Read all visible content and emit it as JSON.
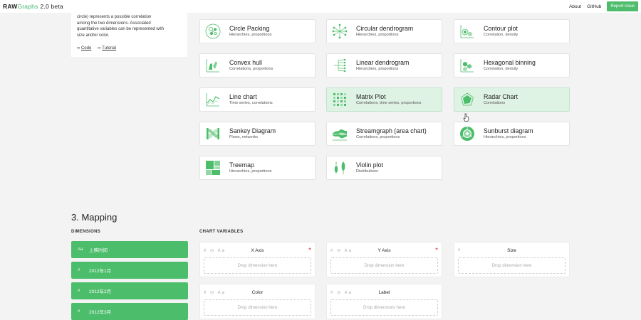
{
  "header": {
    "brand_raw": "RAW",
    "brand_graphs": "Graphs",
    "brand_version": "2.0 beta",
    "nav": [
      "About",
      "GitHub"
    ],
    "report_label": "Report issue"
  },
  "description": {
    "lines": [
      "circle) represents a possible correlation",
      "among the two dimensions. Associated",
      "quantitative variables can be represented with",
      "size and/or color."
    ],
    "code_link": "Code",
    "tutorial_link": "Tutorial"
  },
  "charts": [
    {
      "title": "Circle Packing",
      "subtitle": "Hierarchies, proportions",
      "icon": "circle-packing-icon"
    },
    {
      "title": "Circular dendrogram",
      "subtitle": "Hierarchies, proportions",
      "icon": "circular-dendrogram-icon"
    },
    {
      "title": "Contour plot",
      "subtitle": "Correlation, density",
      "icon": "contour-plot-icon"
    },
    {
      "title": "Convex hull",
      "subtitle": "Correlations, proportions",
      "icon": "convex-hull-icon"
    },
    {
      "title": "Linear dendrogram",
      "subtitle": "Hierarchies, proportions",
      "icon": "linear-dendrogram-icon"
    },
    {
      "title": "Hexagonal binning",
      "subtitle": "Correlation, density",
      "icon": "hexagonal-binning-icon"
    },
    {
      "title": "Line chart",
      "subtitle": "Time series, correlations",
      "icon": "line-chart-icon"
    },
    {
      "title": "Matrix Plot",
      "subtitle": "Correlations, time series, proportions",
      "icon": "matrix-plot-icon"
    },
    {
      "title": "Radar Chart",
      "subtitle": "Correlations",
      "icon": "radar-chart-icon"
    },
    {
      "title": "Sankey Diagram",
      "subtitle": "Flows, networks",
      "icon": "sankey-diagram-icon"
    },
    {
      "title": "Streamgraph (area chart)",
      "subtitle": "Correlations, proportions",
      "icon": "streamgraph-icon"
    },
    {
      "title": "Sunburst diagram",
      "subtitle": "Hierarchies, proportions",
      "icon": "sunburst-diagram-icon"
    },
    {
      "title": "Treemap",
      "subtitle": "Hierarchies, proportions",
      "icon": "treemap-icon"
    },
    {
      "title": "Violin plot",
      "subtitle": "Distributions",
      "icon": "violin-plot-icon"
    }
  ],
  "mapping": {
    "title": "3. Mapping",
    "dimensions_label": "DIMENSIONS",
    "variables_label": "CHART VARIABLES",
    "dimensions": [
      {
        "type": "Aa",
        "name": "上映时间"
      },
      {
        "type": "#",
        "name": "2012年1月"
      },
      {
        "type": "#",
        "name": "2012年2月"
      },
      {
        "type": "#",
        "name": "2012年3月"
      }
    ],
    "variables": [
      {
        "name": "X Axis",
        "types": "# ◷ Aa",
        "required": true,
        "drop": "Drop dimension here"
      },
      {
        "name": "Y Axis",
        "types": "# ◷ Aa",
        "required": true,
        "drop": "Drop dimension here"
      },
      {
        "name": "Size",
        "types": "#",
        "required": false,
        "drop": "Drop dimension here"
      },
      {
        "name": "Color",
        "types": "# ◷ Aa",
        "required": false,
        "drop": "Drop dimension here"
      },
      {
        "name": "Label",
        "types": "# ◷ Aa",
        "required": false,
        "drop": "Drop dimensions here"
      }
    ],
    "required_mark": "*"
  },
  "colors": {
    "accent": "#4cbd6b",
    "highlight": "#dff3e5",
    "required": "#e0393e"
  }
}
